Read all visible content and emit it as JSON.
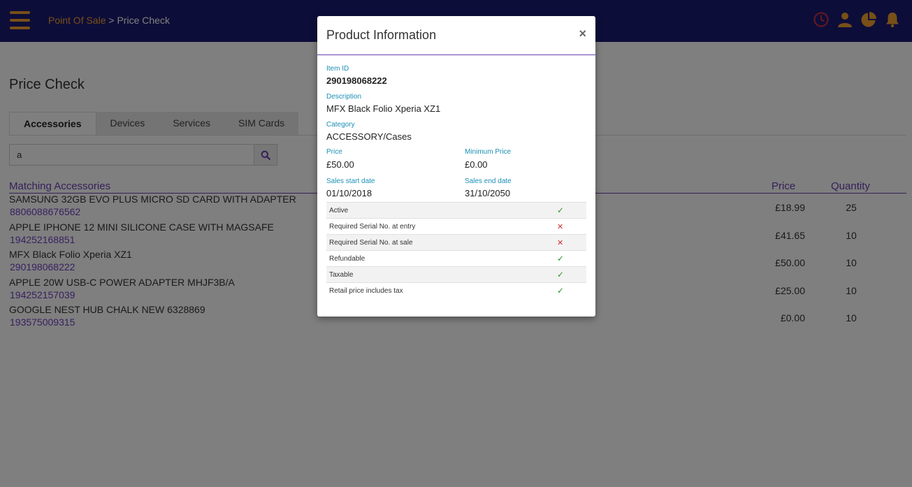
{
  "breadcrumb": {
    "link": "Point Of Sale",
    "separator": " > ",
    "current": "Price Check"
  },
  "page_title": "Price Check",
  "tabs": [
    {
      "label": "Accessories",
      "active": true
    },
    {
      "label": "Devices",
      "active": false
    },
    {
      "label": "Services",
      "active": false
    },
    {
      "label": "SIM Cards",
      "active": false
    }
  ],
  "search": {
    "value": "a"
  },
  "list": {
    "title": "Matching Accessories",
    "price_header": "Price",
    "qty_header": "Quantity",
    "items": [
      {
        "name": "SAMSUNG 32GB EVO PLUS MICRO SD CARD WITH ADAPTER",
        "code": "8806088676562",
        "price": "£18.99",
        "qty": "25"
      },
      {
        "name": "APPLE IPHONE 12 MINI SILICONE CASE WITH MAGSAFE",
        "code": "194252168851",
        "price": "£41.65",
        "qty": "10"
      },
      {
        "name": "MFX Black Folio Xperia XZ1",
        "code": "290198068222",
        "price": "£50.00",
        "qty": "10"
      },
      {
        "name": "APPLE 20W USB-C POWER ADAPTER MHJF3B/A",
        "code": "194252157039",
        "price": "£25.00",
        "qty": "10"
      },
      {
        "name": "GOOGLE NEST HUB CHALK NEW 6328869",
        "code": "193575009315",
        "price": "£0.00",
        "qty": "10"
      }
    ]
  },
  "modal": {
    "title": "Product Information",
    "close": "×",
    "item_id_label": "Item ID",
    "item_id": "290198068222",
    "description_label": "Description",
    "description": "MFX Black Folio Xperia XZ1",
    "category_label": "Category",
    "category": "ACCESSORY/Cases",
    "price_label": "Price",
    "price": "£50.00",
    "min_price_label": "Minimum Price",
    "min_price": "£0.00",
    "start_label": "Sales start date",
    "start": "01/10/2018",
    "end_label": "Sales end date",
    "end": "31/10/2050",
    "flags": [
      {
        "label": "Active",
        "mark": "✓",
        "value": true
      },
      {
        "label": "Required Serial No. at entry",
        "mark": "✕",
        "value": false
      },
      {
        "label": "Required Serial No. at sale",
        "mark": "✕",
        "value": false
      },
      {
        "label": "Refundable",
        "mark": "✓",
        "value": true
      },
      {
        "label": "Taxable",
        "mark": "✓",
        "value": true
      },
      {
        "label": "Retail price includes tax",
        "mark": "✓",
        "value": true
      }
    ]
  },
  "icons": {
    "menu": "hamburger-menu-icon",
    "clock": "clock-icon",
    "user": "user-icon",
    "chart": "pie-chart-icon",
    "bell": "bell-icon",
    "search": "search-icon"
  },
  "colors": {
    "topbar": "#1a1a72",
    "accent": "#f0a030",
    "purple": "#6a3fb0",
    "label_blue": "#1a8fb5",
    "check_green": "#2a9a2a",
    "cross_red": "#d03030"
  }
}
